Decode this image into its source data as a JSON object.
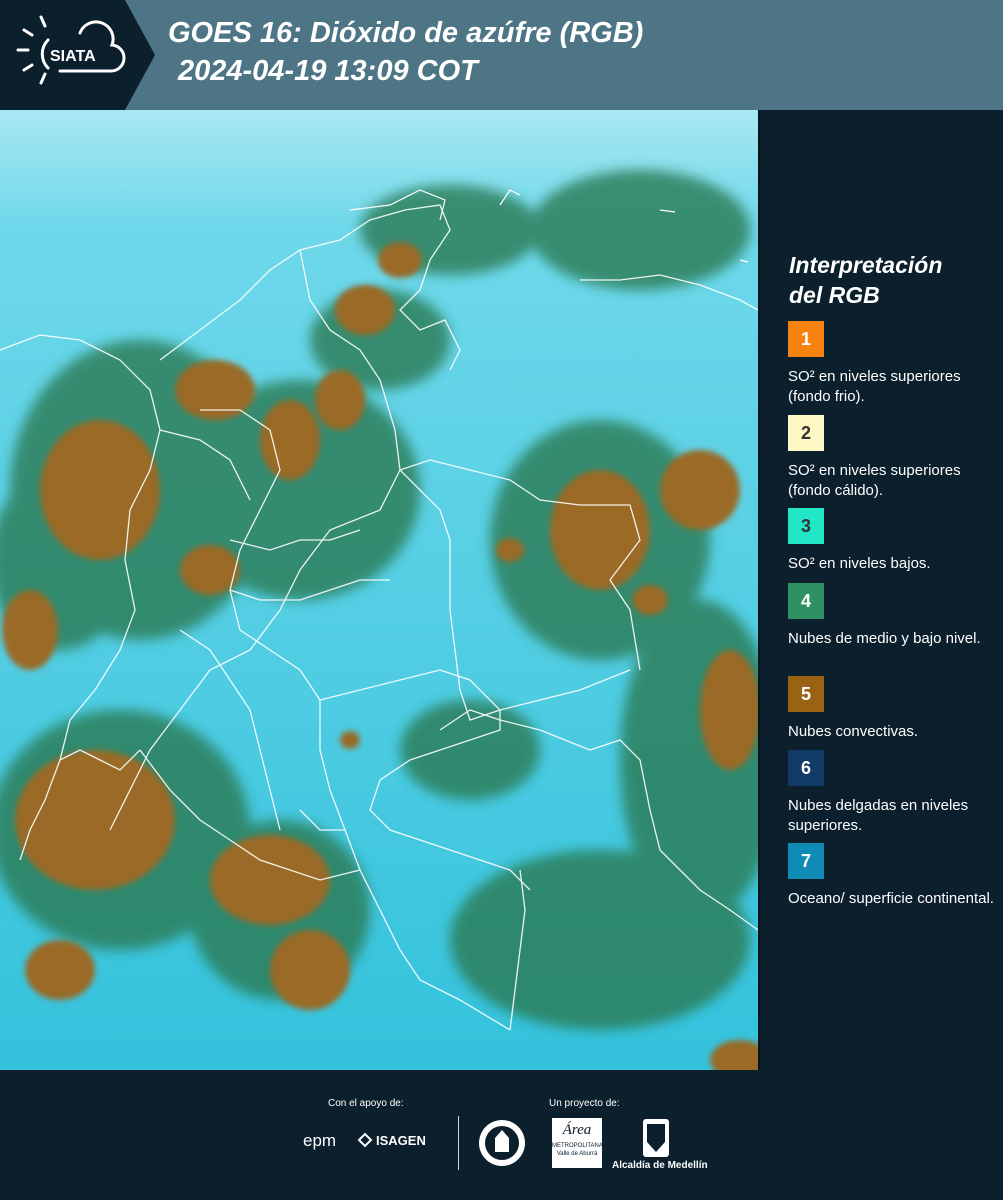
{
  "header": {
    "logo_text": "SIATA",
    "title_line1": "GOES 16: Dióxido de azúfre (RGB)",
    "title_line2": "2024-04-19 13:09 COT"
  },
  "legend": {
    "title_line1": "Interpretación",
    "title_line2": "del RGB",
    "items": [
      {
        "number": "1",
        "color": "#f7820f",
        "text_color": "#ffffff",
        "text": "SO² en niveles superiores (fondo frio)."
      },
      {
        "number": "2",
        "color": "#fff8c4",
        "text_color": "#333333",
        "text": "SO² en niveles superiores (fondo cálido)."
      },
      {
        "number": "3",
        "color": "#22e7c7",
        "text_color": "#333333",
        "text": "SO² en niveles bajos."
      },
      {
        "number": "4",
        "color": "#2f9163",
        "text_color": "#ffffff",
        "text": "Nubes de medio y bajo nivel."
      },
      {
        "number": "5",
        "color": "#9a6213",
        "text_color": "#ffffff",
        "text": "Nubes convectivas."
      },
      {
        "number": "6",
        "color": "#113a66",
        "text_color": "#ffffff",
        "text": "Nubes delgadas en niveles superiores."
      },
      {
        "number": "7",
        "color": "#0f8bb5",
        "text_color": "#ffffff",
        "text": "Oceano/ superficie continental."
      }
    ]
  },
  "footer": {
    "support_label": "Con el apoyo de:",
    "project_label": "Un proyecto de:",
    "logo_epm": "epm",
    "logo_isagen": "ISAGEN",
    "logo_area_line1": "Área",
    "logo_area_line2": "METROPOLITANA",
    "logo_area_line3": "Valle de Aburrá",
    "logo_alcaldia": "Alcaldía de Medellín"
  },
  "colors": {
    "header": "#4d7585",
    "background": "#0b1f2c",
    "cloud_tops": "#9a6a25",
    "surface": "#39c6e0",
    "mid_clouds": "#2f7f52"
  }
}
